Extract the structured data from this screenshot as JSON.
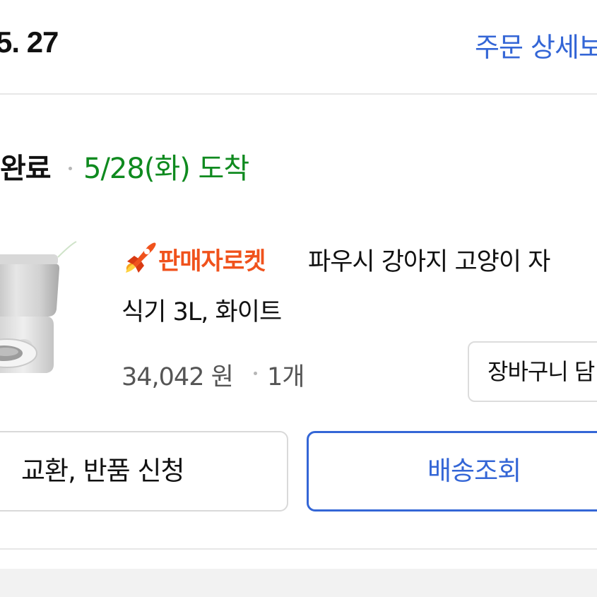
{
  "order": {
    "date": "5. 27",
    "detail_link": "주문 상세보"
  },
  "shipment": {
    "status": "완료",
    "arrival": "5/28(화) 도착",
    "status_color": "#0f8a1f"
  },
  "product": {
    "image_icon": "pet-feeder-product-image",
    "badge_icon": "rocket-icon",
    "badge_label": "판매자로켓",
    "badge_color": "#f0521c",
    "name_line1": "파우시 강아지 고양이 자",
    "name_line2": "식기 3L, 화이트",
    "price": "34,042 원",
    "quantity": "1개",
    "cart_button_label": "장바구니 담"
  },
  "actions": {
    "exchange_label": "교환, 반품 신청",
    "tracking_label": "배송조회",
    "accent_color": "#3466d6"
  }
}
